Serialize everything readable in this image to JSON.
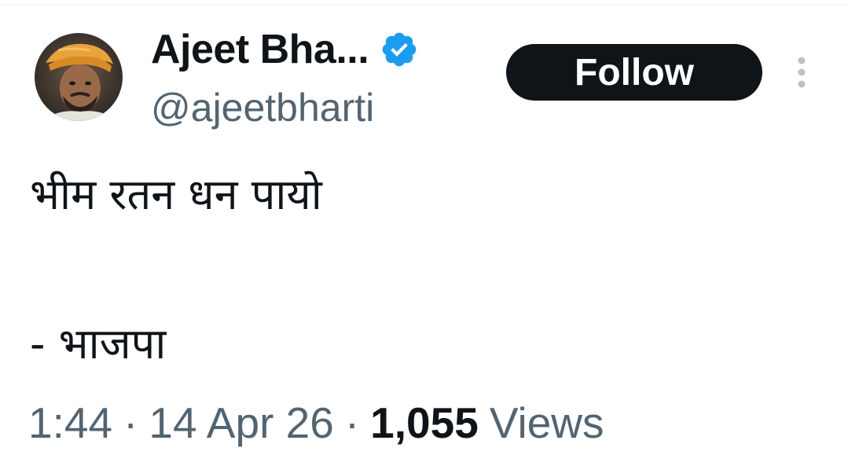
{
  "author": {
    "display_name": "Ajeet Bha...",
    "handle": "@ajeetbharti",
    "verified": true,
    "avatar_icon": "profile-photo-man-orange-turban"
  },
  "actions": {
    "follow_label": "Follow",
    "more_icon": "vertical-ellipsis-icon"
  },
  "tweet": {
    "lines": [
      "भीम रतन धन पायो",
      "- भाजपा"
    ]
  },
  "meta": {
    "time": "1:44",
    "separator": "·",
    "date": "14 Apr 26",
    "views_count": "1,055",
    "views_label": "Views"
  },
  "colors": {
    "text_primary": "#0f1419",
    "text_secondary": "#536471",
    "verified_blue": "#1d9bf0",
    "follow_bg": "#0f1419"
  }
}
